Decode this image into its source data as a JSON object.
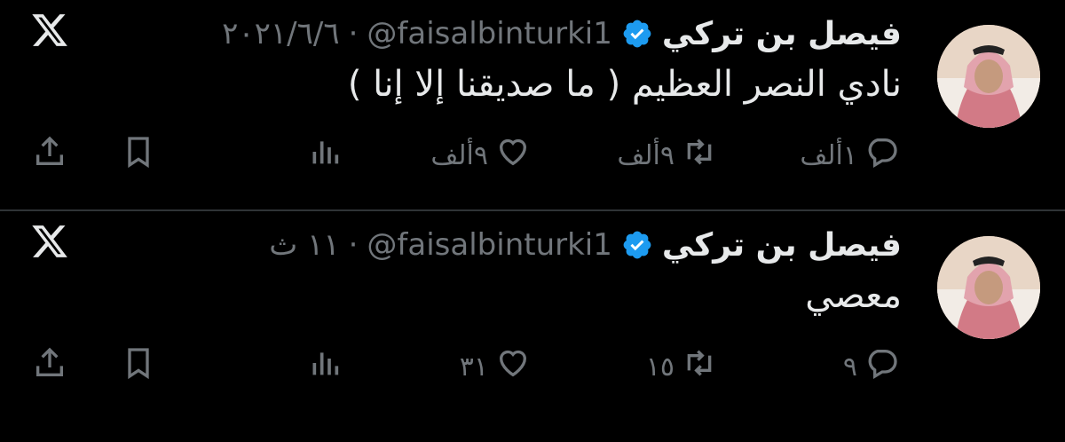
{
  "tweets": [
    {
      "author_name": "فيصل بن تركي",
      "handle": "@faisalbinturki1",
      "separator": "·",
      "time": "٢٠٢١/٦/٦",
      "text": "نادي النصر العظيم ( ما صديقنا إلا إنا )",
      "replies": "١ألف",
      "retweets": "٩ألف",
      "likes": "٩ألف",
      "views": ""
    },
    {
      "author_name": "فيصل بن تركي",
      "handle": "@faisalbinturki1",
      "separator": "·",
      "time": "١١ ث",
      "text": "معصي",
      "replies": "٩",
      "retweets": "١٥",
      "likes": "٣١",
      "views": ""
    }
  ],
  "colors": {
    "background": "#000000",
    "text": "#e7e9ea",
    "muted": "#71767b",
    "verified": "#1d9bf0",
    "divider": "#2f3336"
  },
  "icons": [
    "x-logo-icon",
    "verified-badge-icon",
    "reply-icon",
    "retweet-icon",
    "like-icon",
    "views-icon",
    "bookmark-icon",
    "share-icon"
  ]
}
